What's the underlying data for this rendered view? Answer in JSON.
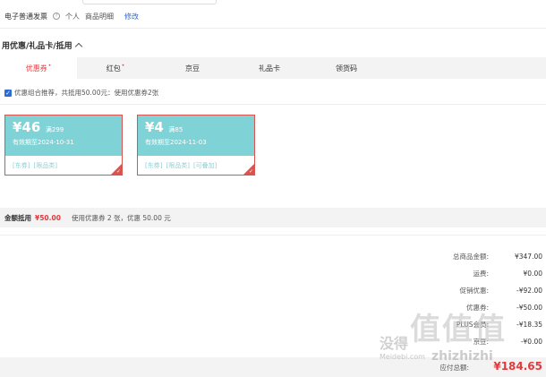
{
  "invoice": {
    "type_label": "电子普通发票",
    "personal": "个人",
    "detail": "商品明细",
    "edit": "修改"
  },
  "section": {
    "title": "用优惠/礼品卡/抵用"
  },
  "tabs": [
    {
      "label": "优惠券",
      "dot": "•"
    },
    {
      "label": "红包",
      "dot": "•"
    },
    {
      "label": "京豆"
    },
    {
      "label": "礼品卡"
    },
    {
      "label": "领货码"
    }
  ],
  "combo": {
    "text": "优惠组合推荐，共抵用50.00元：使用优惠券2张"
  },
  "coupons": [
    {
      "amount": "¥46",
      "condition": "满299",
      "valid": "有效期至2024-10-31",
      "tags": [
        "[东券]",
        "[限品类]"
      ]
    },
    {
      "amount": "¥4",
      "condition": "满85",
      "valid": "有效期至2024-11-03",
      "tags": [
        "[东券]",
        "[限品类]",
        "[可叠加]"
      ]
    }
  ],
  "discount_bar": {
    "label": "金额抵用",
    "amount": "¥50.00",
    "desc": "使用优惠券 2 张，优惠 50.00 元"
  },
  "summary": [
    {
      "k": "总商品金额:",
      "v": "¥347.00"
    },
    {
      "k": "运费:",
      "v": "¥0.00"
    },
    {
      "k": "促销优惠:",
      "v": "-¥92.00"
    },
    {
      "k": "优惠券:",
      "v": "-¥50.00"
    },
    {
      "k": "PLUS会员:",
      "v": "-¥18.35"
    },
    {
      "k": "京豆:",
      "v": "-¥0.00"
    }
  ],
  "total": {
    "label": "应付总额:",
    "value": "¥184.65"
  },
  "watermark": {
    "small": "没得",
    "big": "值值值",
    "url": "Meidebi.com",
    "url2": "zhizhizhi"
  }
}
